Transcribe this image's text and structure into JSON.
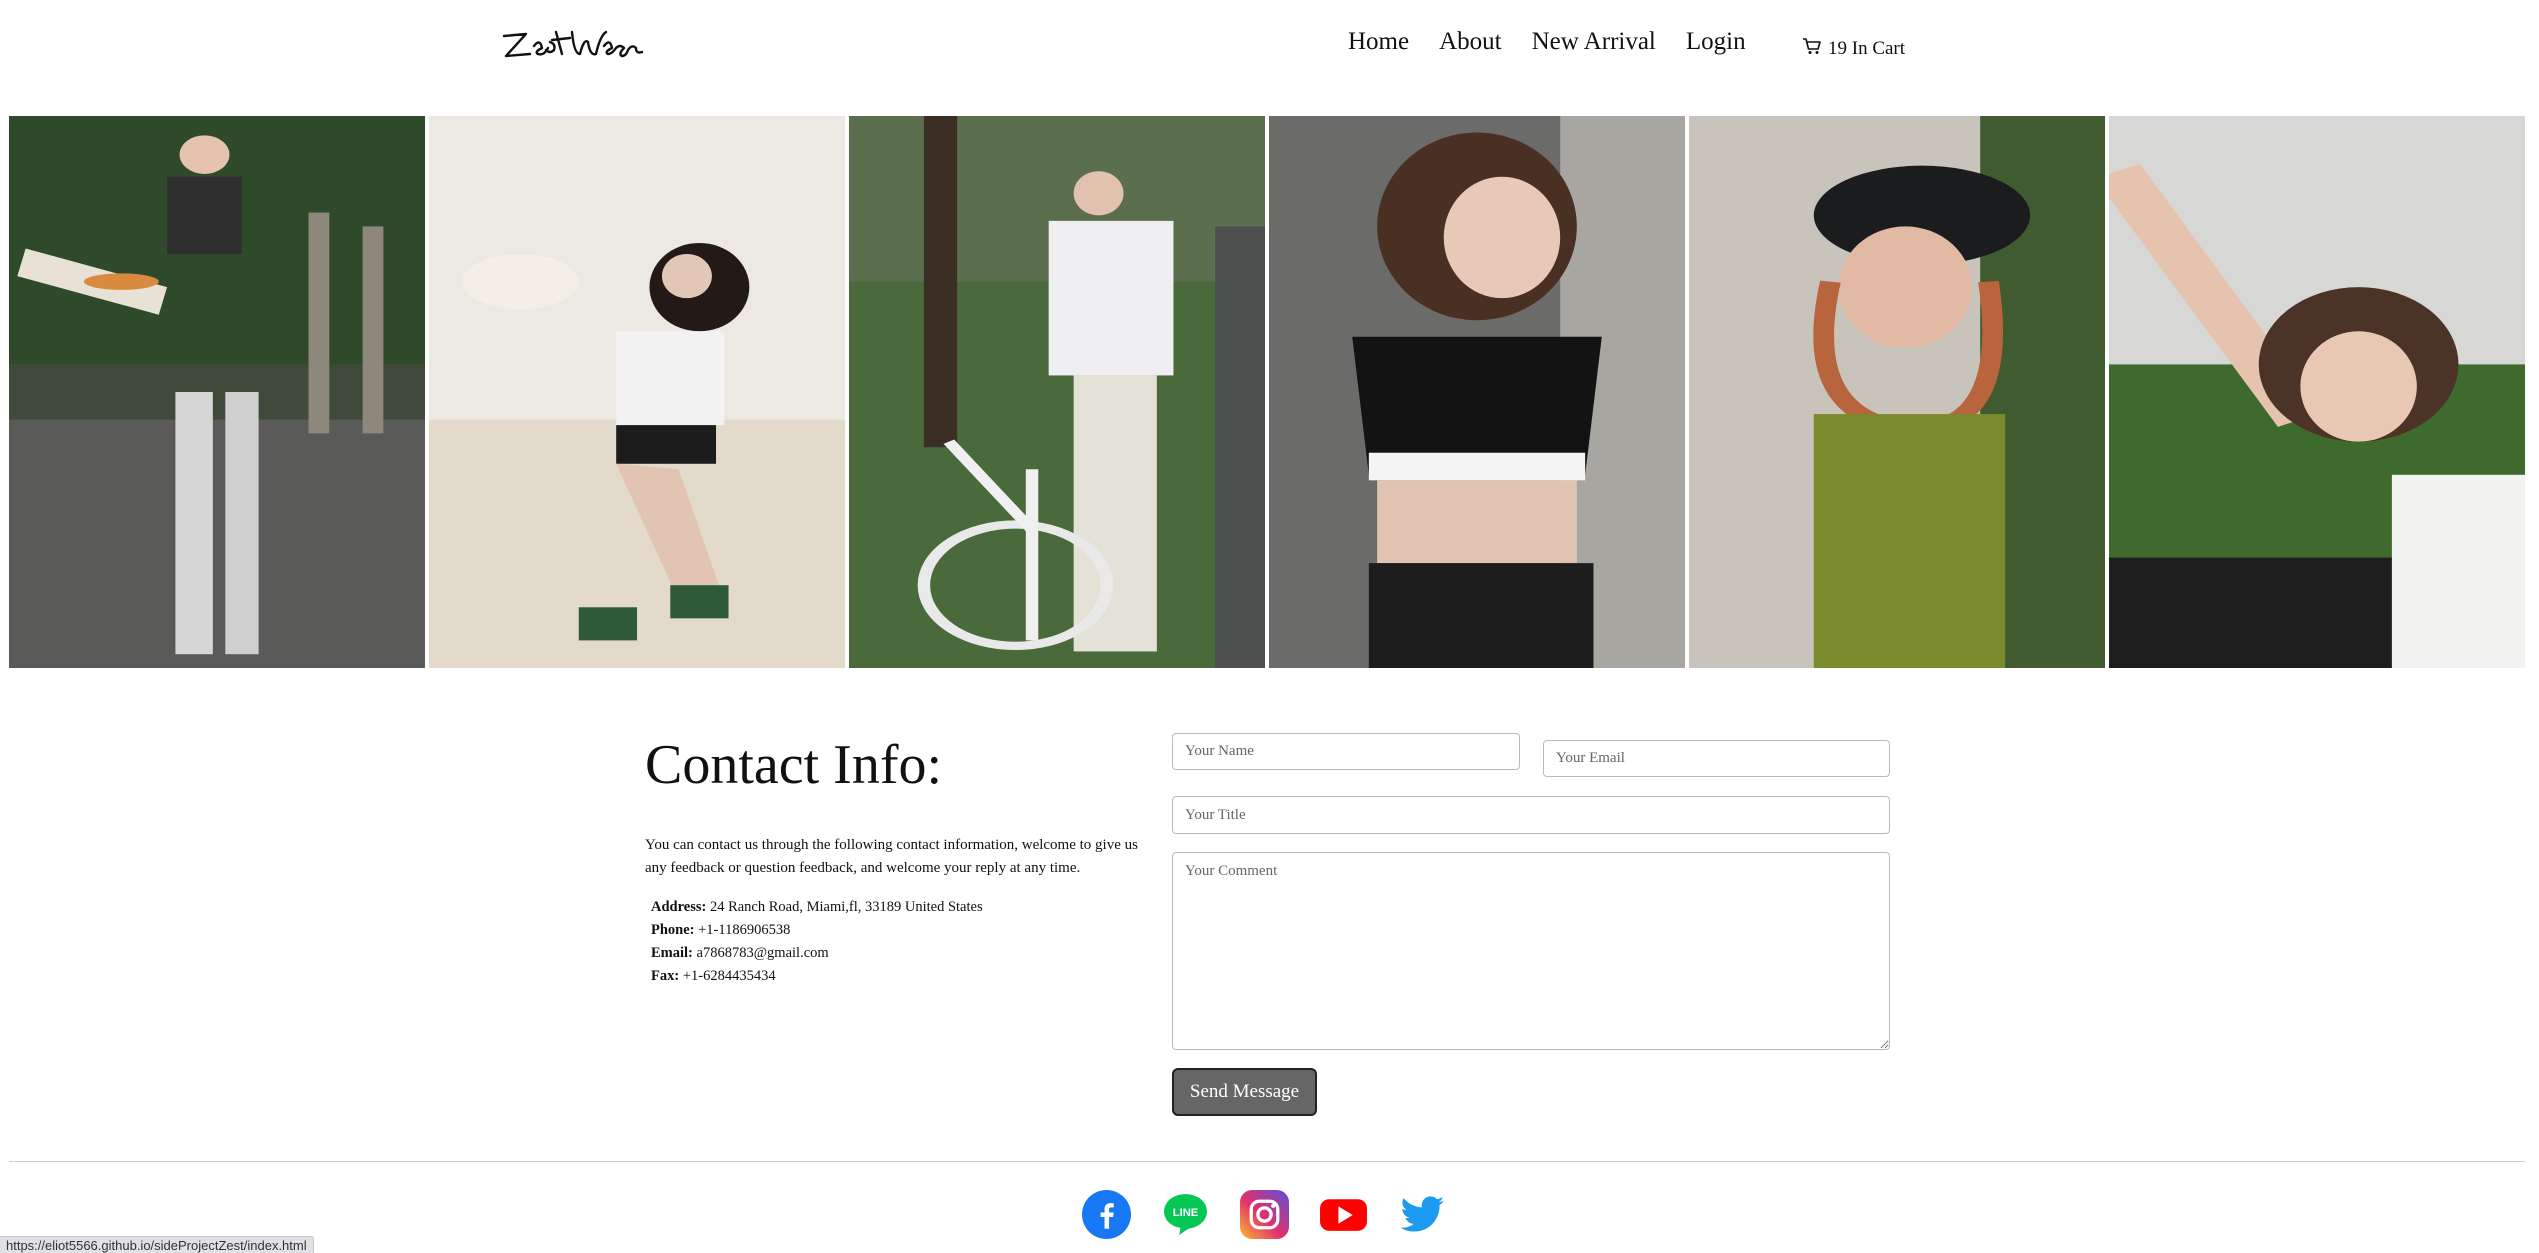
{
  "header": {
    "logo_text": "ZestWear",
    "nav": [
      "Home",
      "About",
      "New Arrival",
      "Login"
    ],
    "cart_label": "19 In Cart",
    "cart_icon": "cart-icon"
  },
  "gallery": [
    {
      "alt": "model-pizza-box"
    },
    {
      "alt": "model-sunglasses-sitting"
    },
    {
      "alt": "model-bicycle"
    },
    {
      "alt": "model-black-crop-top"
    },
    {
      "alt": "model-cap-green-top"
    },
    {
      "alt": "model-car-window"
    }
  ],
  "contact": {
    "title": "Contact Info:",
    "description": "You can contact us through the following contact information, welcome to give us any feedback or question feedback, and welcome your reply at any time.",
    "address_label": "Address:",
    "address": "24 Ranch Road, Miami,fl, 33189 United States",
    "phone_label": "Phone:",
    "phone": "+1-1186906538",
    "email_label": "Email:",
    "email": "a7868783@gmail.com",
    "fax_label": "Fax:",
    "fax": "+1-6284435434"
  },
  "form": {
    "name_placeholder": "Your Name",
    "email_placeholder": "Your Email",
    "title_placeholder": "Your Title",
    "comment_placeholder": "Your Comment",
    "send_label": "Send Message"
  },
  "footer": {
    "socials": [
      "facebook-icon",
      "line-icon",
      "instagram-icon",
      "youtube-icon",
      "twitter-icon"
    ],
    "line_text": "LINE"
  },
  "statusbar": {
    "url": "https://eliot5566.github.io/sideProjectZest/index.html"
  },
  "colors": {
    "button": "#666666",
    "facebook": "#1877f2",
    "line": "#06c755",
    "youtube": "#ff0000",
    "twitter": "#1d9bf0"
  }
}
